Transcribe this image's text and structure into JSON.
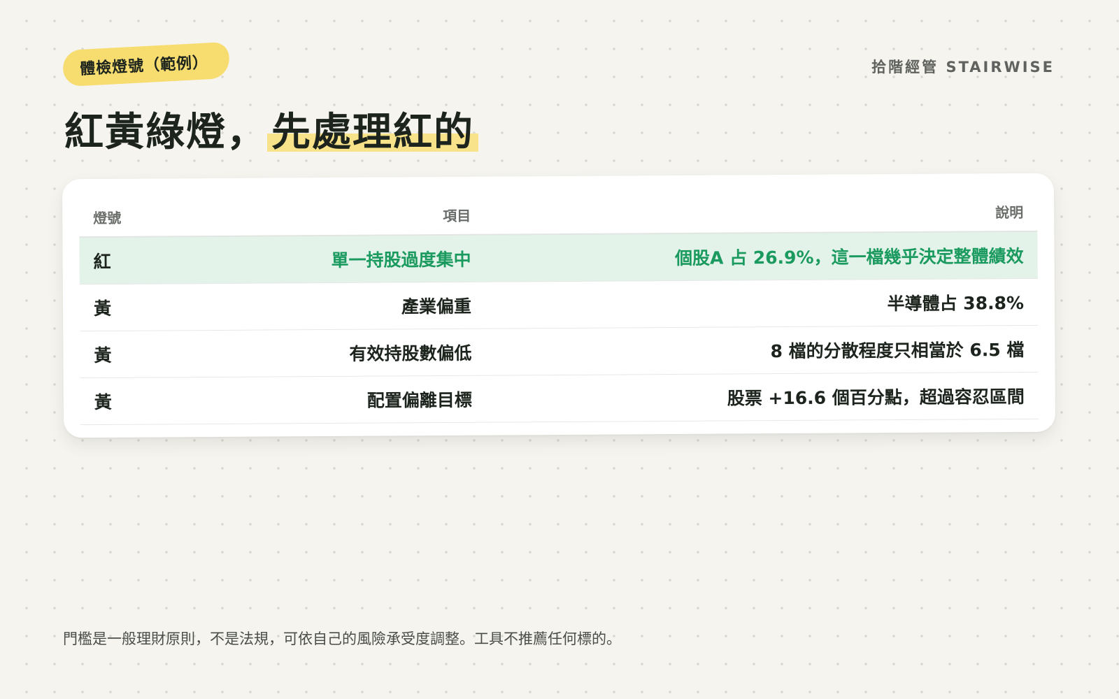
{
  "tag": "體檢燈號（範例）",
  "brand": "拾階經管 STAIRWISE",
  "headline": {
    "main": "紅黃綠燈，",
    "highlight": "先處理紅的"
  },
  "table": {
    "headers": {
      "light": "燈號",
      "item": "項目",
      "description": "說明"
    },
    "rows": [
      {
        "light": "紅",
        "item": "單一持股過度集中",
        "description": "個股A 占 26.9%，這一檔幾乎決定整體績效"
      },
      {
        "light": "黃",
        "item": "產業偏重",
        "description": "半導體占 38.8%"
      },
      {
        "light": "黃",
        "item": "有效持股數偏低",
        "description": "8 檔的分散程度只相當於 6.5 檔"
      },
      {
        "light": "黃",
        "item": "配置偏離目標",
        "description": "股票 +16.6 個百分點，超過容忍區間"
      }
    ]
  },
  "footnote": "門檻是一般理財原則，不是法規，可依自己的風險承受度調整。工具不推薦任何標的。",
  "colors": {
    "background": "#f5f4ee",
    "tag": "#f7dc6f",
    "highlight": "#f9e38a",
    "red_row_bg": "#e3f3ea",
    "red_row_text": "#1a9a5e"
  }
}
